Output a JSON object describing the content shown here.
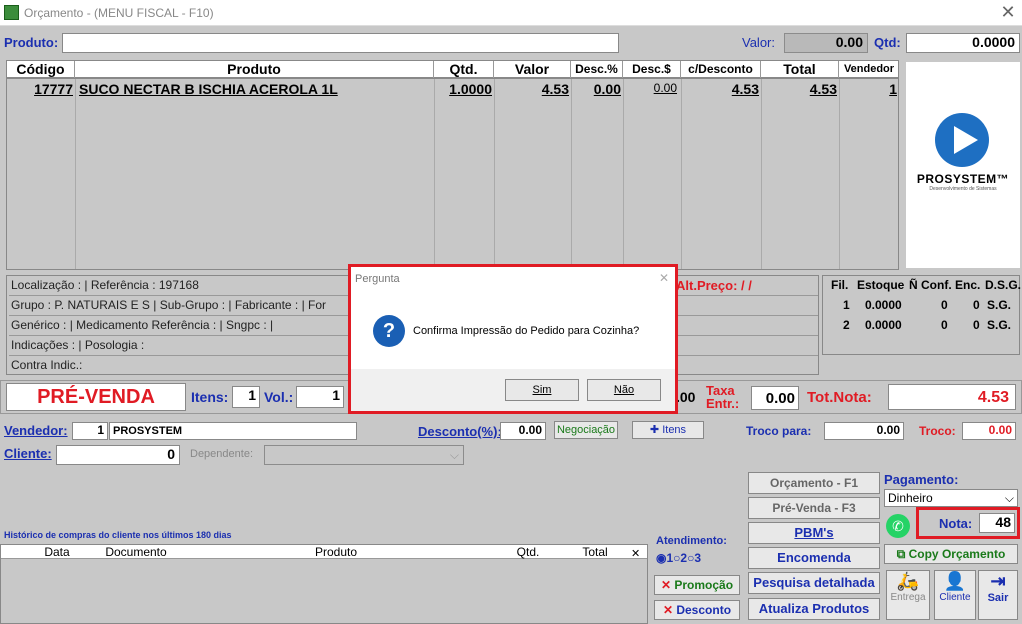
{
  "window": {
    "title": "Orçamento - (MENU FISCAL - F10)"
  },
  "header": {
    "produto_label": "Produto:",
    "valor_label": "Valor:",
    "valor_value": "0.00",
    "qtd_label": "Qtd:",
    "qtd_value": "0.0000"
  },
  "grid": {
    "headers": [
      "Código",
      "Produto",
      "Qtd.",
      "Valor",
      "Desc.%",
      "Desc.$",
      "c/Desconto",
      "Total",
      "Vendedor"
    ],
    "rows": [
      {
        "codigo": "17777",
        "produto": "SUCO NECTAR B ISCHIA ACEROLA 1L",
        "qtd": "1.0000",
        "valor": "4.53",
        "desc_pct": "0.00",
        "desc_val": "0.00",
        "c_desconto": "4.53",
        "total": "4.53",
        "vendedor": "1"
      }
    ]
  },
  "logo": {
    "brand": "PROSYSTEM™",
    "tagline": "Desenvolvimento de Sistemas"
  },
  "info": {
    "line1": "Localização :  | Referência : 197168",
    "line2": "Grupo : P. NATURAIS E S  | Sub-Grupo :  | Fabricante :  | For",
    "line3": "Genérico :  | Medicamento Referência :  | Sngpc :  |",
    "line4": "Indicações :  | Posologia :",
    "line5": "Contra Indic.:",
    "alt_preco": "Alt.Preço:  / /"
  },
  "stock": {
    "headers": [
      "Fil.",
      "Estoque",
      "Ñ Conf.",
      "Enc.",
      "D.S.G."
    ],
    "rows": [
      {
        "fil": "1",
        "estoque": "0.0000",
        "nconf": "0",
        "enc": "0",
        "dsg": "S.G."
      },
      {
        "fil": "2",
        "estoque": "0.0000",
        "nconf": "0",
        "enc": "0",
        "dsg": "S.G."
      }
    ]
  },
  "strip": {
    "mode": "PRÉ-VENDA",
    "itens_label": "Itens:",
    "itens_value": "1",
    "vol_label": "Vol.:",
    "vol_value": "1",
    "partial_value": ".00",
    "taxa_label": "Taxa Entr.:",
    "taxa_value": "0.00",
    "totnota_label": "Tot.Nota:",
    "totnota_value": "4.53"
  },
  "seller": {
    "vendedor_label": "Vendedor:",
    "vendedor_code": "1",
    "vendedor_name": "PROSYSTEM",
    "desconto_label": "Desconto(%):",
    "desconto_value": "0.00",
    "negociacao": "Negociação",
    "itens_btn": "Itens",
    "troco_para_label": "Troco para:",
    "troco_para_value": "0.00",
    "troco_label": "Troco:",
    "troco_value": "0.00"
  },
  "client": {
    "cliente_label": "Cliente:",
    "cliente_value": "0",
    "dependente_label": "Dependente:"
  },
  "history": {
    "caption": "Histórico de compras do cliente nos últimos 180 dias",
    "headers": [
      "Data",
      "Documento",
      "Produto",
      "Qtd.",
      "Total"
    ]
  },
  "atendimento": {
    "label": "Atendimento:",
    "opt1": "1",
    "opt2": "2",
    "opt3": "3"
  },
  "actions": {
    "promocao": "Promoção",
    "desconto": "Desconto",
    "orcamento": "Orçamento - F1",
    "prevenda": "Pré-Venda - F3",
    "pbms": "PBM's",
    "encomenda": "Encomenda",
    "pesquisa": "Pesquisa detalhada",
    "atualiza": "Atualiza Produtos"
  },
  "payment": {
    "label": "Pagamento:",
    "selected": "Dinheiro",
    "nota_label": "Nota:",
    "nota_value": "48",
    "copy": "Copy Orçamento",
    "entrega": "Entrega",
    "cliente": "Cliente",
    "sair": "Sair"
  },
  "dialog": {
    "title": "Pergunta",
    "message": "Confirma Impressão do Pedido para Cozinha?",
    "yes": "Sim",
    "no": "Não"
  },
  "colors": {
    "accent_blue": "#1b2fb0",
    "alert_red": "#e01b24"
  }
}
